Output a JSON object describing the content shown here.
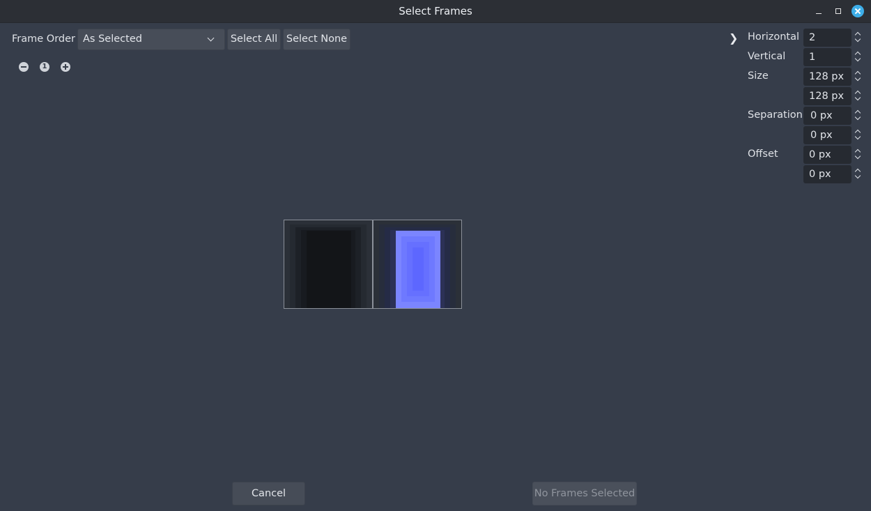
{
  "window": {
    "title": "Select Frames"
  },
  "toolbar": {
    "frame_order_label": "Frame Order",
    "frame_order_value": "As Selected",
    "select_all": "Select All",
    "select_none": "Select None"
  },
  "zoom": {
    "reset_label": "1"
  },
  "expander": {
    "glyph": "❯"
  },
  "grid": {
    "horizontal_label": "Horizontal",
    "horizontal_value": "2",
    "vertical_label": "Vertical",
    "vertical_value": "1",
    "size_label": "Size",
    "size_x": "128 px",
    "size_y": "128 px",
    "separation_label": "Separation",
    "separation_x": "0 px",
    "separation_y": "0 px",
    "offset_label": "Offset",
    "offset_x": "0 px",
    "offset_y": "0 px"
  },
  "footer": {
    "cancel": "Cancel",
    "confirm": "No Frames Selected"
  },
  "colors": {
    "background": "#363d4a",
    "frame_dark": "#16181c",
    "frame_blue": "#7b85ff",
    "accent_close": "#3daee9"
  }
}
